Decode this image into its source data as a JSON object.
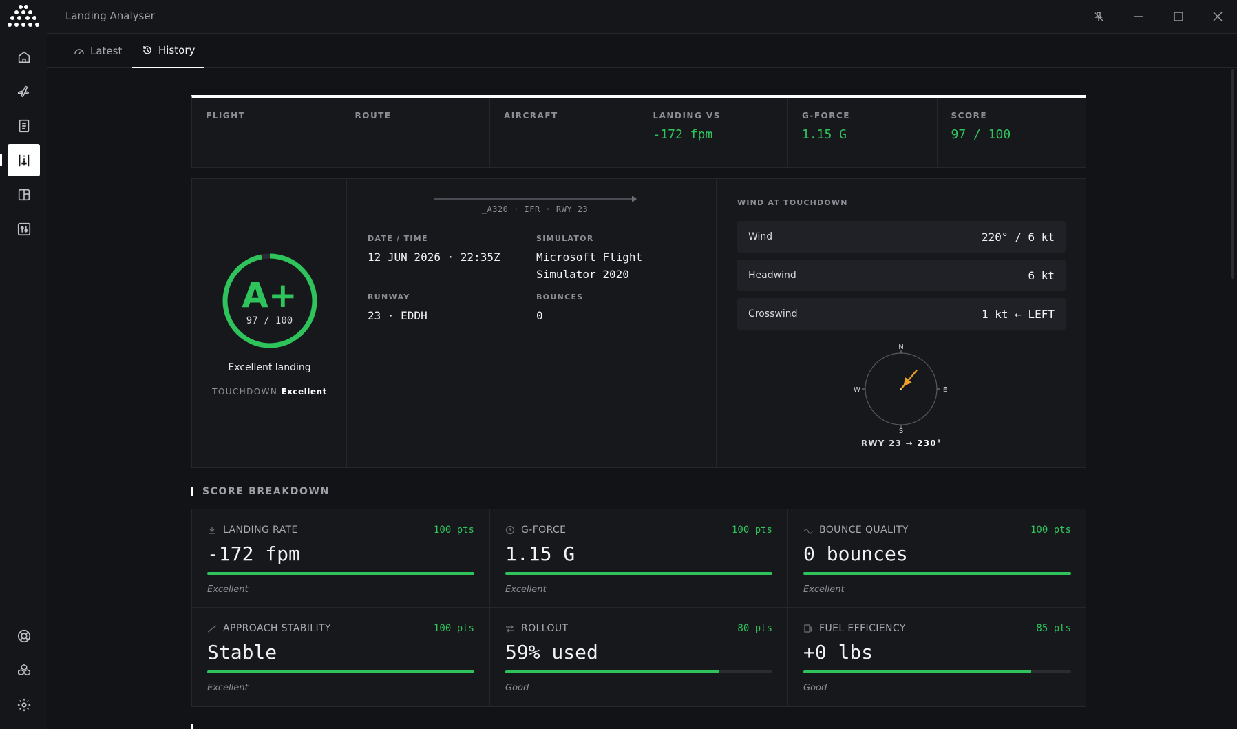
{
  "app": {
    "title": "Landing Analyser"
  },
  "tabs": [
    {
      "label": "Latest",
      "icon": "gauge-icon",
      "active": false
    },
    {
      "label": "History",
      "icon": "history-icon",
      "active": true
    }
  ],
  "summary": {
    "flight": {
      "label": "FLIGHT",
      "value": ""
    },
    "route": {
      "label": "ROUTE",
      "value": ""
    },
    "aircraft": {
      "label": "AIRCRAFT",
      "value": ""
    },
    "landing_vs": {
      "label": "LANDING VS",
      "value": "-172 fpm"
    },
    "g_force": {
      "label": "G-FORCE",
      "value": "1.15 G"
    },
    "score": {
      "label": "SCORE",
      "value": "97 / 100"
    }
  },
  "grade": {
    "letter": "A+",
    "score": "97 / 100",
    "score_fraction": 0.97,
    "text": "Excellent landing",
    "touchdown_label": "TOUCHDOWN",
    "touchdown_value": "Excellent"
  },
  "info": {
    "route_sub": "_A320 · IFR · RWY 23",
    "datetime": {
      "label": "DATE / TIME",
      "value": "12 JUN 2026 · 22:35Z"
    },
    "simulator": {
      "label": "SIMULATOR",
      "value": "Microsoft Flight Simulator 2020"
    },
    "runway": {
      "label": "RUNWAY",
      "value": "23 · EDDH"
    },
    "bounces": {
      "label": "BOUNCES",
      "value": "0"
    }
  },
  "wind": {
    "title": "WIND AT TOUCHDOWN",
    "rows": [
      {
        "label": "Wind",
        "value": "220° / 6 kt"
      },
      {
        "label": "Headwind",
        "value": "6 kt"
      },
      {
        "label": "Crosswind",
        "value": "1 kt ← LEFT"
      }
    ],
    "compass": {
      "n": "N",
      "e": "E",
      "s": "S",
      "w": "W",
      "wind_direction_deg": 220
    },
    "runway_label": "RWY 23 →",
    "runway_heading": "230°"
  },
  "breakdown": {
    "title": "SCORE BREAKDOWN",
    "metrics": [
      {
        "name": "LANDING RATE",
        "icon": "download-icon",
        "points": "100 pts",
        "value": "-172 fpm",
        "fraction": 1.0,
        "rating": "Excellent"
      },
      {
        "name": "G-FORCE",
        "icon": "clock-icon",
        "points": "100 pts",
        "value": "1.15 G",
        "fraction": 1.0,
        "rating": "Excellent"
      },
      {
        "name": "BOUNCE QUALITY",
        "icon": "wave-icon",
        "points": "100 pts",
        "value": "0 bounces",
        "fraction": 1.0,
        "rating": "Excellent"
      },
      {
        "name": "APPROACH STABILITY",
        "icon": "slope-icon",
        "points": "100 pts",
        "value": "Stable",
        "fraction": 1.0,
        "rating": "Excellent"
      },
      {
        "name": "ROLLOUT",
        "icon": "arrows-icon",
        "points": "80 pts",
        "value": "59% used",
        "fraction": 0.8,
        "rating": "Good"
      },
      {
        "name": "FUEL EFFICIENCY",
        "icon": "fuel-icon",
        "points": "85 pts",
        "value": "+0 lbs",
        "fraction": 0.85,
        "rating": "Good"
      }
    ]
  },
  "colors": {
    "accent": "#2fc35c",
    "wind_arrow": "#f0a028",
    "background": "#121317"
  }
}
